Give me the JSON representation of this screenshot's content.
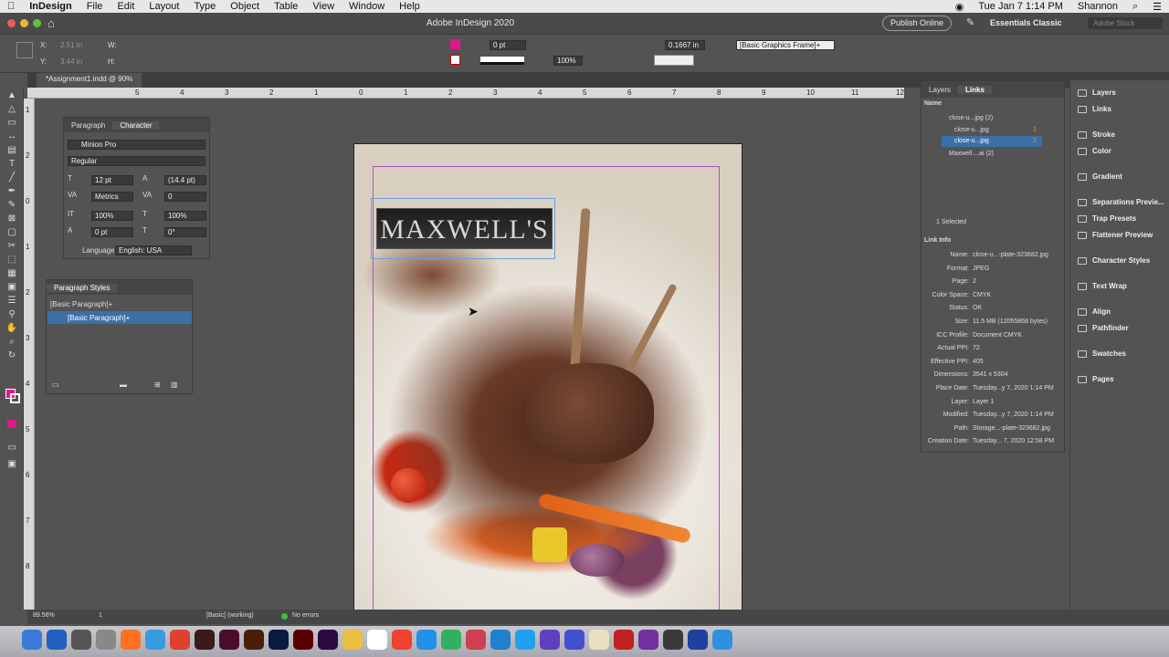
{
  "menubar": {
    "app": "InDesign",
    "items": [
      "File",
      "Edit",
      "Layout",
      "Type",
      "Object",
      "Table",
      "View",
      "Window",
      "Help"
    ],
    "clock": "Tue Jan 7  1:14 PM",
    "user": "Shannon"
  },
  "titlebar": {
    "title": "Adobe InDesign 2020",
    "publish": "Publish Online",
    "workspace": "Essentials Classic",
    "search_placeholder": "Adobe Stock"
  },
  "control": {
    "x": "2.51 in",
    "y": "3.44 in",
    "w_label": "W:",
    "h_label": "H:",
    "stroke_pt": "0 pt",
    "zoom": "100%",
    "ref_value": "0.1667 in",
    "frame_style": "[Basic Graphics Frame]+"
  },
  "doc_tab": "*Assignment1.indd @ 90%",
  "ruler_h": [
    "5",
    "4",
    "3",
    "2",
    "1",
    "0",
    "1",
    "2",
    "3",
    "4",
    "5",
    "6",
    "7",
    "8",
    "9",
    "10",
    "11",
    "12"
  ],
  "ruler_v": [
    "1",
    "2",
    "0",
    "1",
    "2",
    "3",
    "4",
    "5",
    "6",
    "7",
    "8"
  ],
  "page": {
    "logo_text": "MAXWELL'S"
  },
  "character_panel": {
    "tab_paragraph": "Paragraph",
    "tab_character": "Character",
    "font": "Minion Pro",
    "style": "Regular",
    "size": "12 pt",
    "leading": "(14.4 pt)",
    "kerning": "Metrics",
    "tracking": "0",
    "vscale": "100%",
    "hscale": "100%",
    "baseline": "0 pt",
    "skew": "0°",
    "language_label": "Language:",
    "language": "English: USA"
  },
  "para_styles": {
    "title": "Paragraph Styles",
    "current": "[Basic Paragraph]+",
    "selected": "[Basic Paragraph]+"
  },
  "status": {
    "zoom": "89.56%",
    "page": "1",
    "style": "[Basic] (working)",
    "errors": "No errors"
  },
  "links": {
    "tab_layers": "Layers",
    "tab_links": "Links",
    "name_header": "Name",
    "items": [
      {
        "name": "close-u...jpg (2)",
        "page": ""
      },
      {
        "name": "close-u...jpg",
        "page": "1"
      },
      {
        "name": "close-u...jpg",
        "page": "2"
      },
      {
        "name": "Maxwell....ai (2)",
        "page": ""
      }
    ],
    "selected_count": "1 Selected",
    "info_title": "Link Info",
    "info": [
      [
        "Name:",
        "close-u...-plate-323682.jpg"
      ],
      [
        "Format:",
        "JPEG"
      ],
      [
        "Page:",
        "2"
      ],
      [
        "Color Space:",
        "CMYK"
      ],
      [
        "Status:",
        "OK"
      ],
      [
        "Size:",
        "11.5 MB (12055868 bytes)"
      ],
      [
        "ICC Profile:",
        "Document CMYK"
      ],
      [
        "Actual PPI:",
        "72"
      ],
      [
        "Effective PPI:",
        "405"
      ],
      [
        "Dimensions:",
        "3541 x 5304"
      ],
      [
        "Place Date:",
        "Tuesday...y 7, 2020 1:14 PM"
      ],
      [
        "Layer:",
        "Layer 1"
      ],
      [
        "Modified:",
        "Tuesday...y 7, 2020 1:14 PM"
      ],
      [
        "Path:",
        "Storage...-plate-323682.jpg"
      ],
      [
        "Creation Date:",
        "Tuesday... 7, 2020 12:58 PM"
      ]
    ]
  },
  "dock_panels": [
    "Layers",
    "Links",
    "Stroke",
    "Color",
    "Gradient",
    "Separations Previe...",
    "Trap Presets",
    "Flattener Preview",
    "Character Styles",
    "Text Wrap",
    "Align",
    "Pathfinder",
    "Swatches",
    "Pages"
  ],
  "colors": {
    "accent_magenta": "#e0188a",
    "selection_blue": "#3c6fa8"
  }
}
